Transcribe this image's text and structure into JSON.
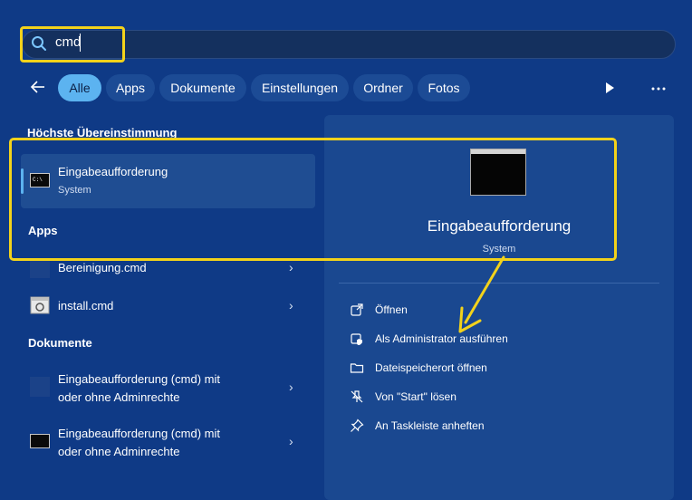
{
  "search": {
    "value": "cmd"
  },
  "filters": {
    "tabs": [
      {
        "label": "Alle",
        "active": true
      },
      {
        "label": "Apps"
      },
      {
        "label": "Dokumente"
      },
      {
        "label": "Einstellungen"
      },
      {
        "label": "Ordner"
      },
      {
        "label": "Fotos"
      }
    ]
  },
  "left": {
    "best_match_title": "Höchste Übereinstimmung",
    "best_match": {
      "title": "Eingabeaufforderung",
      "subtitle": "System"
    },
    "apps_title": "Apps",
    "apps": [
      {
        "title": "Bereinigung.cmd"
      },
      {
        "title": "install.cmd"
      }
    ],
    "docs_title": "Dokumente",
    "docs": [
      {
        "title_line1": "Eingabeaufforderung (cmd) mit",
        "title_line2": "oder ohne Adminrechte"
      },
      {
        "title_line1": "Eingabeaufforderung (cmd) mit",
        "title_line2": "oder ohne Adminrechte"
      }
    ]
  },
  "right": {
    "app_name": "Eingabeaufforderung",
    "app_type": "System",
    "actions": [
      {
        "label": "Öffnen",
        "icon": "open-external-icon"
      },
      {
        "label": "Als Administrator ausführen",
        "icon": "admin-shield-icon"
      },
      {
        "label": "Dateispeicherort öffnen",
        "icon": "folder-icon"
      },
      {
        "label": "Von \"Start\" lösen",
        "icon": "unpin-icon"
      },
      {
        "label": "An Taskleiste anheften",
        "icon": "pin-icon"
      }
    ]
  },
  "colors": {
    "background": "#0f3a86",
    "accent": "#5cb3f0",
    "highlight_annotation": "#f2d21b"
  }
}
